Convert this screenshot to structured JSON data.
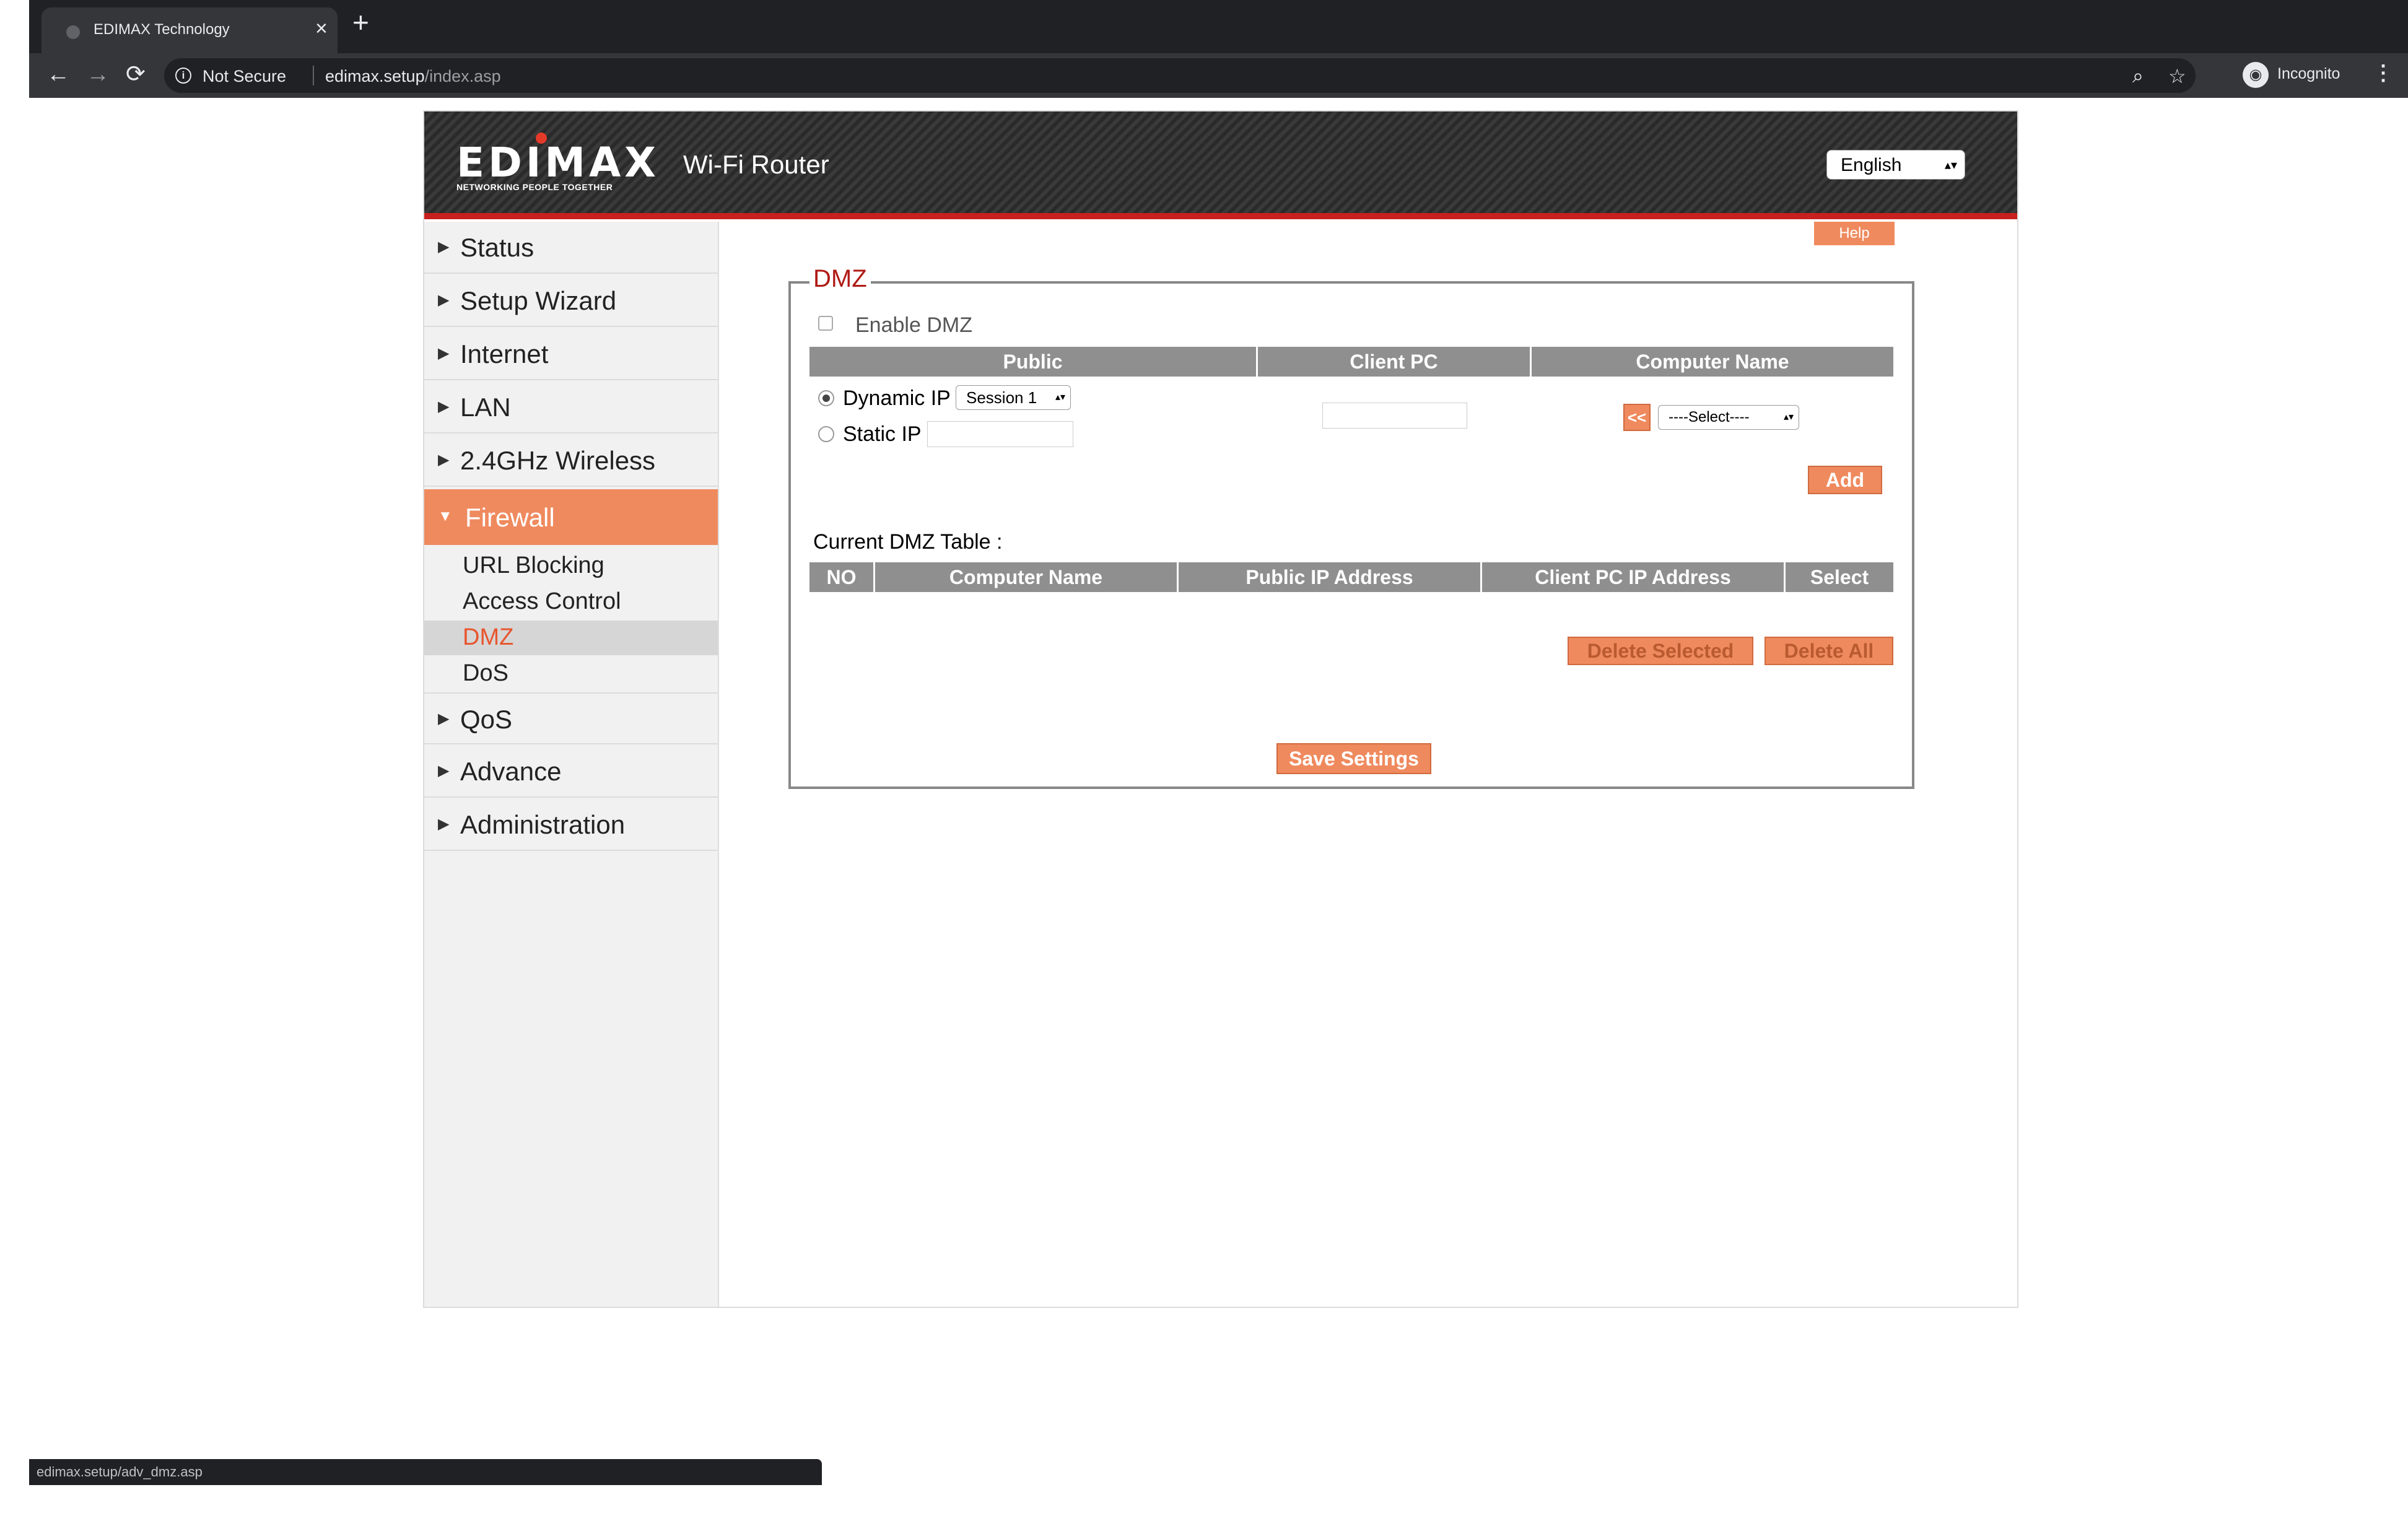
{
  "browser": {
    "tab_title": "EDIMAX Technology",
    "tab_close": "×",
    "new_tab": "+",
    "nav": {
      "back": "←",
      "forward": "→",
      "reload": "⟳"
    },
    "info_icon": "i",
    "security_label": "Not Secure",
    "url_host": "edimax.setup",
    "url_path": "/index.asp",
    "zoom_icon": "⌕",
    "star_icon": "☆",
    "incognito_label": "Incognito",
    "menu_icon": "⋮"
  },
  "header": {
    "logo_text": "EDIMAX",
    "logo_tagline": "NETWORKING PEOPLE TOGETHER",
    "product_title": "Wi-Fi Router",
    "language": "English",
    "accent_color": "#c8201e"
  },
  "sidebar": {
    "collapsed_marker": "▶",
    "expanded_marker": "▼",
    "items": [
      {
        "label": "Status"
      },
      {
        "label": "Setup Wizard"
      },
      {
        "label": "Internet"
      },
      {
        "label": "LAN"
      },
      {
        "label": "2.4GHz Wireless"
      },
      {
        "label": "Firewall",
        "active": true
      },
      {
        "label": "QoS"
      },
      {
        "label": "Advance"
      },
      {
        "label": "Administration"
      }
    ],
    "firewall_sub": [
      {
        "label": "URL Blocking"
      },
      {
        "label": "Access Control"
      },
      {
        "label": "DMZ",
        "current": true
      },
      {
        "label": "DoS"
      }
    ],
    "active_color": "#ef8a5e"
  },
  "content": {
    "help_label": "Help",
    "section_title": "DMZ",
    "enable_label": "Enable  DMZ",
    "enable_checked": false,
    "columns": {
      "public": "Public",
      "client_pc": "Client PC",
      "computer_name": "Computer Name"
    },
    "dynamic_ip_label": "Dynamic IP",
    "dynamic_ip_selected": true,
    "session_value": "Session  1",
    "static_ip_label": "Static IP",
    "static_ip_value": "",
    "client_pc_value": "",
    "copy_button": "<<",
    "computer_select_value": "----Select----",
    "add_button": "Add",
    "table_title": "Current DMZ Table :",
    "table_headers": [
      "NO",
      "Computer Name",
      "Public  IP Address",
      "Client PC  IP Address",
      "Select"
    ],
    "table_rows": [],
    "delete_selected": "Delete Selected",
    "delete_all": "Delete All",
    "save_settings": "Save Settings",
    "select_arrow": "▴▾"
  },
  "status_bar": {
    "url": "edimax.setup/adv_dmz.asp"
  }
}
